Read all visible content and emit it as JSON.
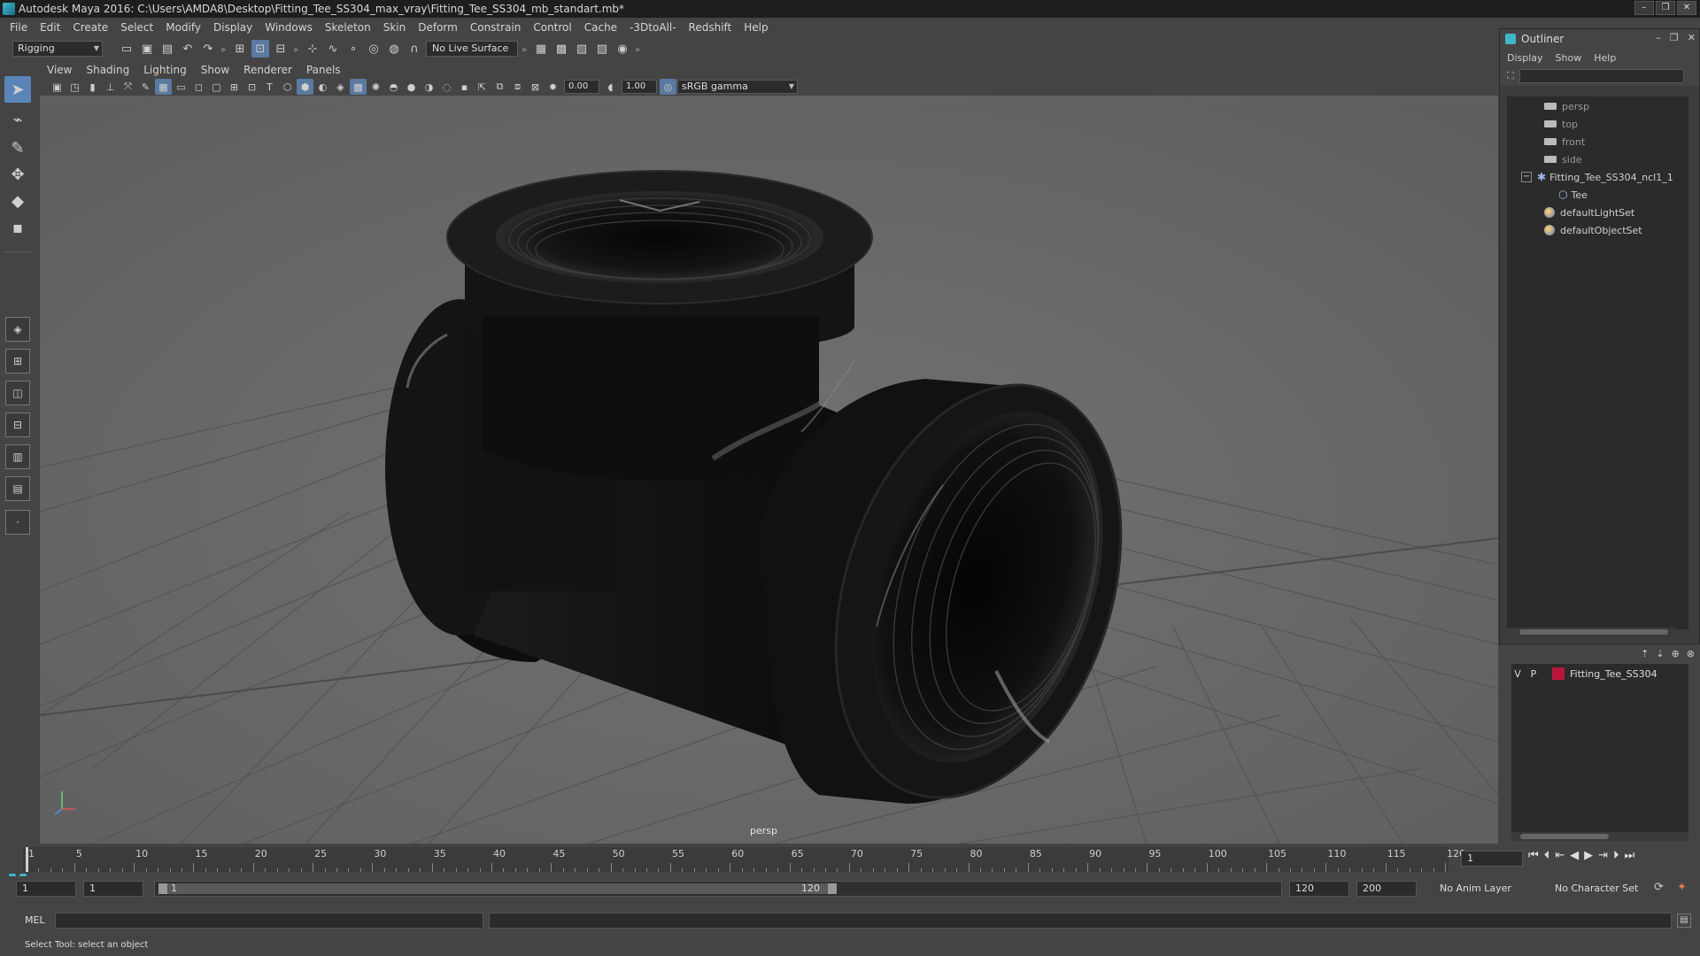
{
  "window": {
    "title": "Autodesk Maya 2016: C:\\Users\\AMDA8\\Desktop\\Fitting_Tee_SS304_max_vray\\Fitting_Tee_SS304_mb_standart.mb*",
    "minimize": "–",
    "maximize": "❐",
    "close": "✕"
  },
  "menubar": {
    "items": [
      "File",
      "Edit",
      "Create",
      "Select",
      "Modify",
      "Display",
      "Windows",
      "Skeleton",
      "Skin",
      "Deform",
      "Constrain",
      "Control",
      "Cache",
      "-3DtoAll-",
      "Redshift",
      "Help"
    ]
  },
  "statusline": {
    "mode": "Rigging",
    "live_surface": "No Live Surface"
  },
  "viewport": {
    "menu": [
      "View",
      "Shading",
      "Lighting",
      "Show",
      "Renderer",
      "Panels"
    ],
    "exposure": "0.00",
    "gamma": "1.00",
    "color_space": "sRGB gamma",
    "camera": "persp"
  },
  "outliner": {
    "title": "Outliner",
    "menu": [
      "Display",
      "Show",
      "Help"
    ],
    "items": [
      {
        "label": "persp"
      },
      {
        "label": "top"
      },
      {
        "label": "front"
      },
      {
        "label": "side"
      },
      {
        "label": "Fitting_Tee_SS304_ncl1_1"
      },
      {
        "label": "Tee"
      },
      {
        "label": "defaultLightSet"
      },
      {
        "label": "defaultObjectSet"
      }
    ]
  },
  "layer_editor": {
    "visible": "V",
    "playback": "P",
    "layer_name": "Fitting_Tee_SS304",
    "layer_color": "#b8163a"
  },
  "timeslider": {
    "ticks": [
      "1",
      "5",
      "10",
      "15",
      "20",
      "25",
      "30",
      "35",
      "40",
      "45",
      "50",
      "55",
      "60",
      "65",
      "70",
      "75",
      "80",
      "85",
      "90",
      "95",
      "100",
      "105",
      "110",
      "115",
      "120"
    ],
    "current_frame": "1"
  },
  "rangeslider": {
    "start": "1",
    "playback_start": "1",
    "range_start_label": "1",
    "range_end_label": "120",
    "playback_end": "120",
    "end": "200",
    "anim_layer": "No Anim Layer",
    "character_set": "No Character Set"
  },
  "cmdline": {
    "language": "MEL"
  },
  "helpline": {
    "text": "Select Tool: select an object"
  }
}
